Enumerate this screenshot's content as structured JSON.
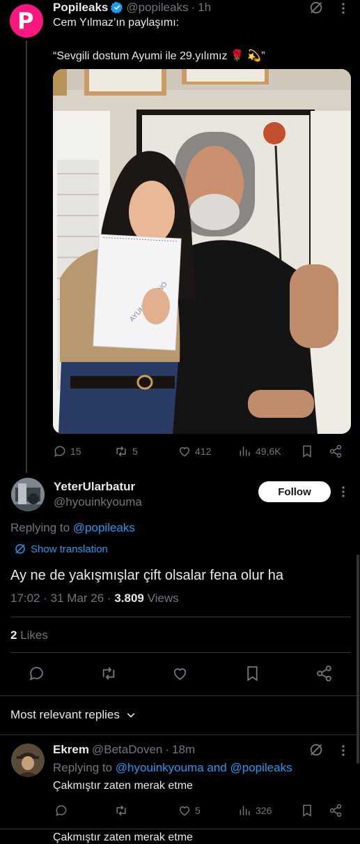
{
  "top_post": {
    "display_name": "Popileaks",
    "handle": "@popileaks",
    "time": "1h",
    "intro_text": "Cem Yılmaz’ın paylaşımı:",
    "quote_text": "“Sevgili dostum Ayumi ile 29.yılımız 🌹 💫”",
    "image_notebook_text": "AYUMI TAKANO",
    "stats": {
      "replies": "15",
      "reposts": "5",
      "likes": "412",
      "views": "49,6K"
    }
  },
  "focused_post": {
    "display_name": "YeterUlarbatur",
    "handle": "@hyouinkyouma",
    "follow_label": "Follow",
    "replying_prefix": "Replying to",
    "replying_to": "@popileaks",
    "show_translation": "Show translation",
    "text": "Ay ne de yakışmışlar çift olsalar fena olur ha",
    "datetime": "17:02 · 31 Mar 26 · ",
    "views_count": "3.809",
    "views_label": "Views",
    "likes_count": "2",
    "likes_label": "Likes"
  },
  "replies_sort": {
    "label": "Most relevant replies"
  },
  "reply": {
    "display_name": "Ekrem",
    "handle": "@BetaDoven",
    "time": "18m",
    "replying_prefix": "Replying to",
    "replying_to": "@hyouinkyouma and @popileaks",
    "text": "Çakmıştır zaten merak etme",
    "stats": {
      "reposts": "",
      "likes": "5",
      "views": "326"
    }
  },
  "next_reply_preview": {
    "text": "Çakmıştır zaten merak etme"
  },
  "colors": {
    "accent": "#1d9bf0",
    "verified": "#1d9bf0",
    "brand": "#f91880",
    "muted": "#71767b"
  },
  "icons": [
    "verified-icon",
    "grok-icon",
    "more-icon",
    "reply-icon",
    "repost-icon",
    "like-icon",
    "views-icon",
    "bookmark-icon",
    "share-icon",
    "translate-icon",
    "chevron-down-icon"
  ]
}
